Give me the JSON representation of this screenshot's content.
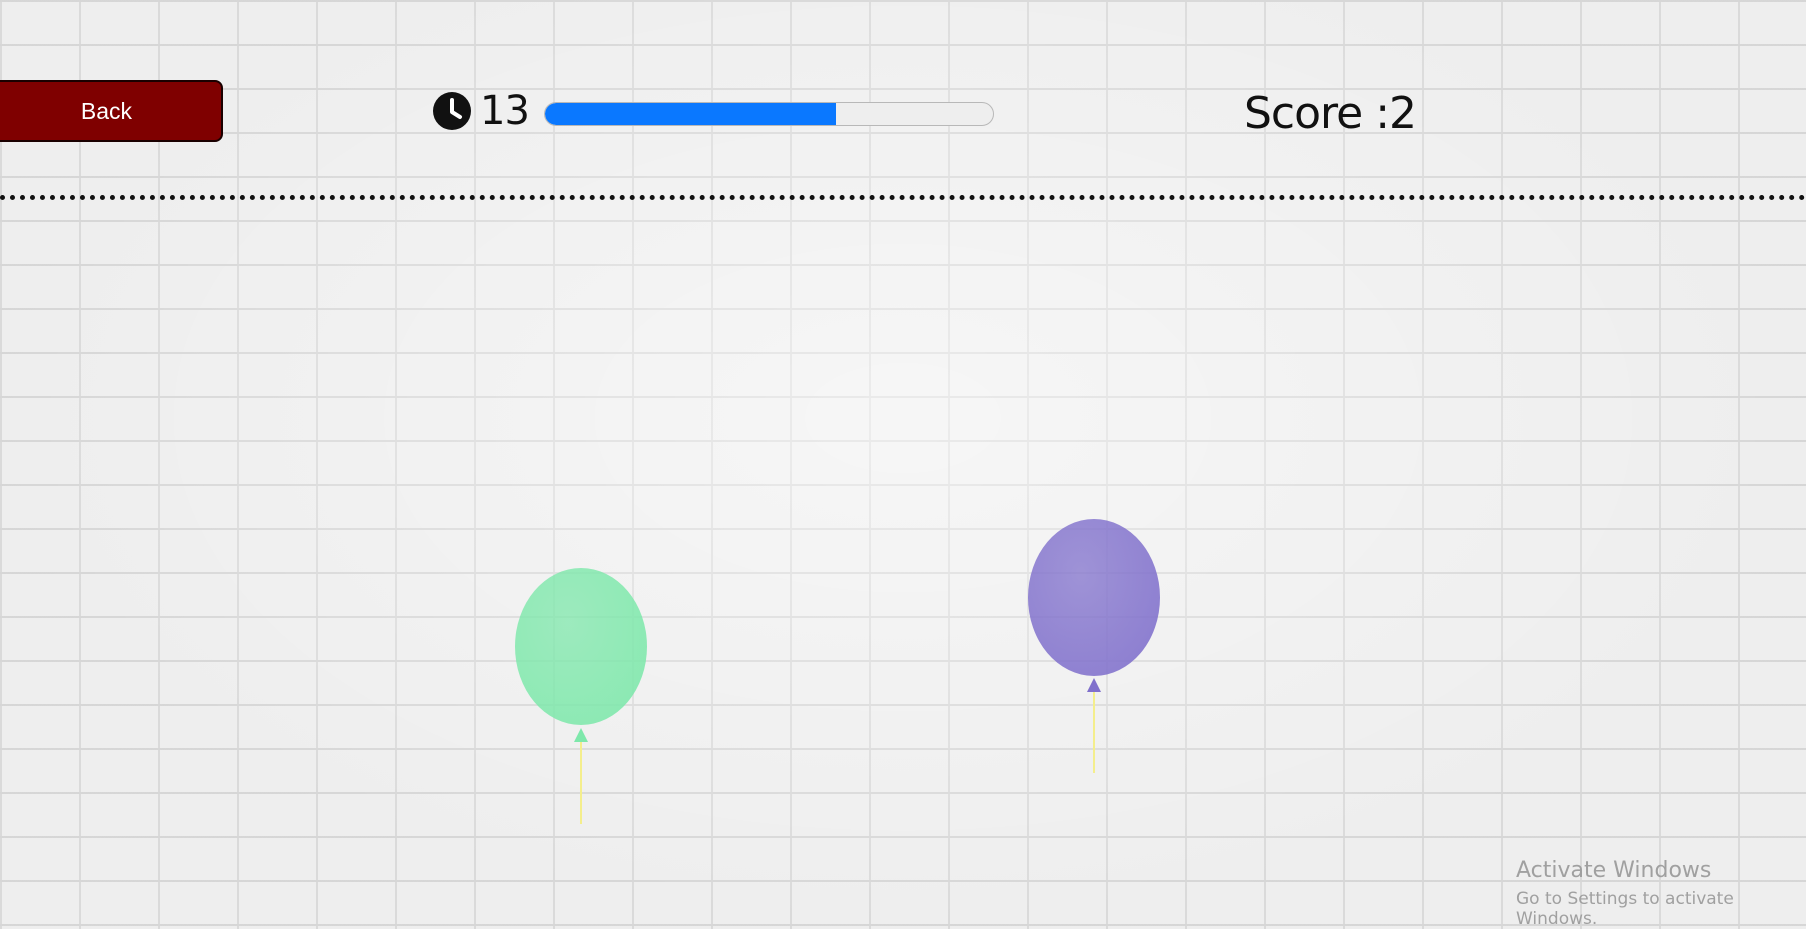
{
  "header": {
    "back_label": "Back",
    "timer_value": "13",
    "timer_icon": "clock-icon",
    "progress_fraction": 0.65,
    "progress_color": "#0a78ff",
    "score_text": "Score :2"
  },
  "balloons": [
    {
      "color": "#7ee8ab"
    },
    {
      "color": "#8070cc"
    }
  ],
  "watermark": {
    "title": "Activate Windows",
    "subtitle": "Go to Settings to activate Windows."
  }
}
